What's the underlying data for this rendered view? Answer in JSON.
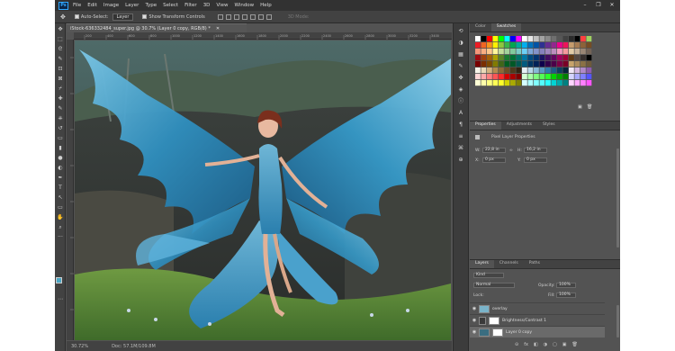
{
  "app": {
    "logo": "Ps"
  },
  "menu": [
    "File",
    "Edit",
    "Image",
    "Layer",
    "Type",
    "Select",
    "Filter",
    "3D",
    "View",
    "Window",
    "Help"
  ],
  "window_controls": {
    "minimize": "–",
    "restore": "❐",
    "close": "✕"
  },
  "options_bar": {
    "auto_select_label": "Auto-Select:",
    "auto_select_value": "Layer",
    "transform_label": "Show Transform Controls",
    "mode_3d_label": "3D Mode:"
  },
  "tools": {
    "move": "✥",
    "marquee": "⬚",
    "lasso": "ᘓ",
    "quick_select": "✎",
    "crop": "⊡",
    "frame": "⊠",
    "eyedropper": "⌿",
    "heal": "✚",
    "brush": "✎",
    "stamp": "⎈",
    "history": "↺",
    "eraser": "▭",
    "gradient": "▮",
    "blur": "●",
    "dodge": "◐",
    "pen": "✒",
    "type": "T",
    "path_select": "↖",
    "shape": "▭",
    "hand": "✋",
    "zoom": "⌕",
    "more": "···",
    "edit_toolbar": "⋯"
  },
  "document": {
    "tab_title": "iStock-636332484_super.jpg @ 30.7% (Layer 0 copy, RGB/8) *",
    "close_glyph": "✕",
    "zoom": "30.72%",
    "doc_size": "Doc: 57.1M/109.8M",
    "ruler_ticks": [
      "200",
      "400",
      "600",
      "800",
      "1000",
      "1200",
      "1400",
      "1600",
      "1800",
      "2000",
      "2200",
      "2400",
      "2600",
      "2800",
      "3000",
      "3200",
      "3400"
    ]
  },
  "side_icons": {
    "history": "⟲",
    "adjust": "◑",
    "swatch": "▦",
    "paths": "✎",
    "brush": "✤",
    "layers": "◈",
    "info": "ⓘ",
    "char": "A",
    "para": "¶",
    "props": "≡",
    "glyph": "⌘",
    "style": "⊕",
    "expand": "»"
  },
  "swatches_panel": {
    "tabs": [
      "Color",
      "Swatches"
    ],
    "row_colors": {
      "row0": [
        "#ffffff",
        "#000000",
        "#ff0000",
        "#ffff00",
        "#00ff00",
        "#00ffff",
        "#0000ff",
        "#ff00ff",
        "#ffffff",
        "#e6e6e6",
        "#bfbfbf",
        "#a3a3a3",
        "#898989",
        "#6f6f6f",
        "#575757",
        "#414141",
        "#2b2b2b",
        "#000000",
        "#ff4040",
        "#a0d060"
      ],
      "row1": [
        "#ed1c24",
        "#f26522",
        "#f7941d",
        "#fff200",
        "#8dc63f",
        "#39b54a",
        "#00a651",
        "#00a99d",
        "#00aeef",
        "#0072bc",
        "#0054a6",
        "#2e3192",
        "#662d91",
        "#92278f",
        "#ec008c",
        "#ed145b",
        "#c69c6d",
        "#a67c52",
        "#8c6239",
        "#754c24"
      ],
      "row2": [
        "#f69679",
        "#f9ad81",
        "#fdc68a",
        "#fff79a",
        "#c4df9b",
        "#a3d39c",
        "#82ca9d",
        "#7accc8",
        "#6dcff6",
        "#7da7d9",
        "#8393ca",
        "#8781bd",
        "#a186be",
        "#bd8cbf",
        "#f49ac1",
        "#f5989d",
        "#e2cba6",
        "#c7b299",
        "#998675",
        "#736357"
      ],
      "row3": [
        "#9e0b0f",
        "#a0410d",
        "#a36209",
        "#aba000",
        "#598527",
        "#1a7b30",
        "#007236",
        "#00746b",
        "#0076a3",
        "#004b80",
        "#003471",
        "#1b1464",
        "#440e62",
        "#630460",
        "#9e005d",
        "#9e0039",
        "#603913",
        "#534741",
        "#362f2d",
        "#000000"
      ],
      "row4": [
        "#790000",
        "#7b2e00",
        "#7d4900",
        "#827b00",
        "#406618",
        "#005e20",
        "#005826",
        "#005952",
        "#005b7f",
        "#003663",
        "#002157",
        "#0d004c",
        "#32004b",
        "#4b0049",
        "#7b0046",
        "#7a0026",
        "#c7a36b",
        "#ab8c5d",
        "#8a7145",
        "#6e5a3b"
      ],
      "row5": [
        "#f7f3e8",
        "#ead9b8",
        "#d4b27f",
        "#b58c4e",
        "#8c6a36",
        "#6d4f26",
        "#4f3a1c",
        "#332412",
        "#e6f0f5",
        "#b8d7e8",
        "#88b9d6",
        "#5a9ac3",
        "#2f7bab",
        "#1d5c85",
        "#103f5e",
        "#06243a",
        "#f0e6f5",
        "#d4b8e0",
        "#b08ac8",
        "#8e5cae"
      ],
      "row6": [
        "#ffd5d5",
        "#ffaaaa",
        "#ff8080",
        "#ff5555",
        "#ff2a2a",
        "#d40000",
        "#aa0000",
        "#800000",
        "#d5ffd5",
        "#aaffaa",
        "#80ff80",
        "#55ff55",
        "#2aff2a",
        "#00d400",
        "#00aa00",
        "#008000",
        "#d5d5ff",
        "#aaaaff",
        "#8080ff",
        "#5555ff"
      ],
      "row7": [
        "#ffffd5",
        "#ffffaa",
        "#ffff80",
        "#ffff55",
        "#ffff2a",
        "#d4d400",
        "#aaaa00",
        "#808000",
        "#d5ffff",
        "#aaffff",
        "#80ffff",
        "#55ffff",
        "#2affff",
        "#00d4d4",
        "#00aaaa",
        "#008080",
        "#ffd5ff",
        "#ffaaff",
        "#ff80ff",
        "#ff55ff"
      ]
    },
    "new_glyph": "▣",
    "trash_glyph": "🗑"
  },
  "properties_panel": {
    "tabs": [
      "Properties",
      "Adjustments",
      "Styles"
    ],
    "header": "Pixel Layer Properties",
    "w_label": "W:",
    "w_value": "22,8 in",
    "link_glyph": "∞",
    "h_label": "H:",
    "h_value": "16,2 in",
    "x_label": "X:",
    "x_value": "0 px",
    "y_label": "Y:",
    "y_value": "0 px"
  },
  "layers_panel": {
    "tabs": [
      "Layers",
      "Channels",
      "Paths"
    ],
    "filter_label": "Kind",
    "blend_mode": "Normal",
    "opacity_label": "Opacity:",
    "opacity_value": "100%",
    "lock_label": "Lock:",
    "fill_label": "Fill:",
    "fill_value": "100%",
    "layers": [
      {
        "name": "overlay",
        "thumb": "#7ab3c9"
      },
      {
        "name": "Brightness/Contrast 1",
        "thumb": "#ffffff"
      },
      {
        "name": "Layer 0 copy",
        "thumb": "#3a6d80"
      }
    ],
    "footer_icons": [
      "⊝",
      "fx",
      "◧",
      "◑",
      "▢",
      "▣",
      "🗑"
    ]
  },
  "colors": {
    "fg": "#4ba7c5",
    "bg": "#ffffff"
  }
}
